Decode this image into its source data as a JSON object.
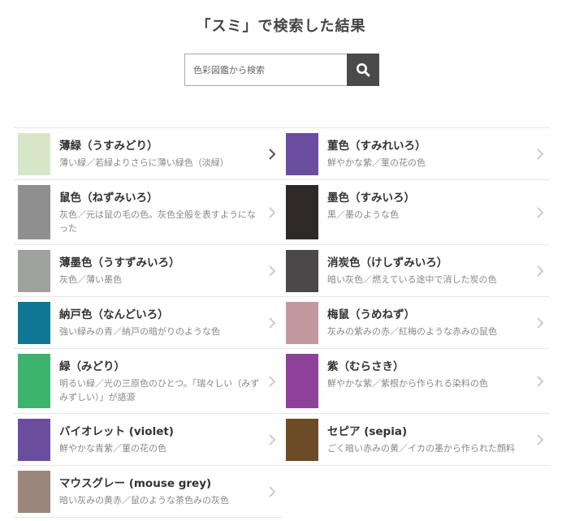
{
  "page": {
    "title": "「スミ」で検索した結果"
  },
  "search": {
    "placeholder": "色彩図鑑から検索"
  },
  "results": [
    {
      "name": "薄緑（うすみどり）",
      "desc": "薄い緑／若緑よりさらに薄い緑色（淡緑）",
      "color": "#d8e6c8"
    },
    {
      "name": "菫色（すみれいろ）",
      "desc": "鮮やかな紫／菫の花の色",
      "color": "#6a4d9f"
    },
    {
      "name": "鼠色（ねずみいろ）",
      "desc": "灰色／元は鼠の毛の色。灰色全般を表すようになった",
      "color": "#8f8f8f"
    },
    {
      "name": "墨色（すみいろ）",
      "desc": "黒／墨のような色",
      "color": "#2e2828"
    },
    {
      "name": "薄墨色（うすずみいろ）",
      "desc": "灰色／薄い墨色",
      "color": "#9ea19e"
    },
    {
      "name": "消炭色（けしずみいろ）",
      "desc": "暗い灰色／燃えている途中で消した炭の色",
      "color": "#4a4848"
    },
    {
      "name": "納戸色（なんどいろ）",
      "desc": "強い緑みの青／納戸の暗がりのような色",
      "color": "#0f7793"
    },
    {
      "name": "梅鼠（うめねず）",
      "desc": "灰みの紫みの赤／紅梅のような赤みの鼠色",
      "color": "#c3989f"
    },
    {
      "name": "緑（みどり）",
      "desc": "明るい緑／光の三原色のひとつ。「瑞々しい（みずみずしい）」が語源",
      "color": "#3db46d"
    },
    {
      "name": "紫（むらさき）",
      "desc": "鮮やかな紫／紫根から作られる染料の色",
      "color": "#8e4199"
    },
    {
      "name": "バイオレット (violet)",
      "desc": "鮮やかな青紫／菫の花の色",
      "color": "#6b4d9d"
    },
    {
      "name": "セピア (sepia)",
      "desc": "ごく暗い赤みの黄／イカの墨から作られた顔料",
      "color": "#6d4b26"
    },
    {
      "name": "マウスグレー (mouse grey)",
      "desc": "暗い灰みの黄赤／鼠のような茶色みの灰色",
      "color": "#9b877b"
    }
  ]
}
